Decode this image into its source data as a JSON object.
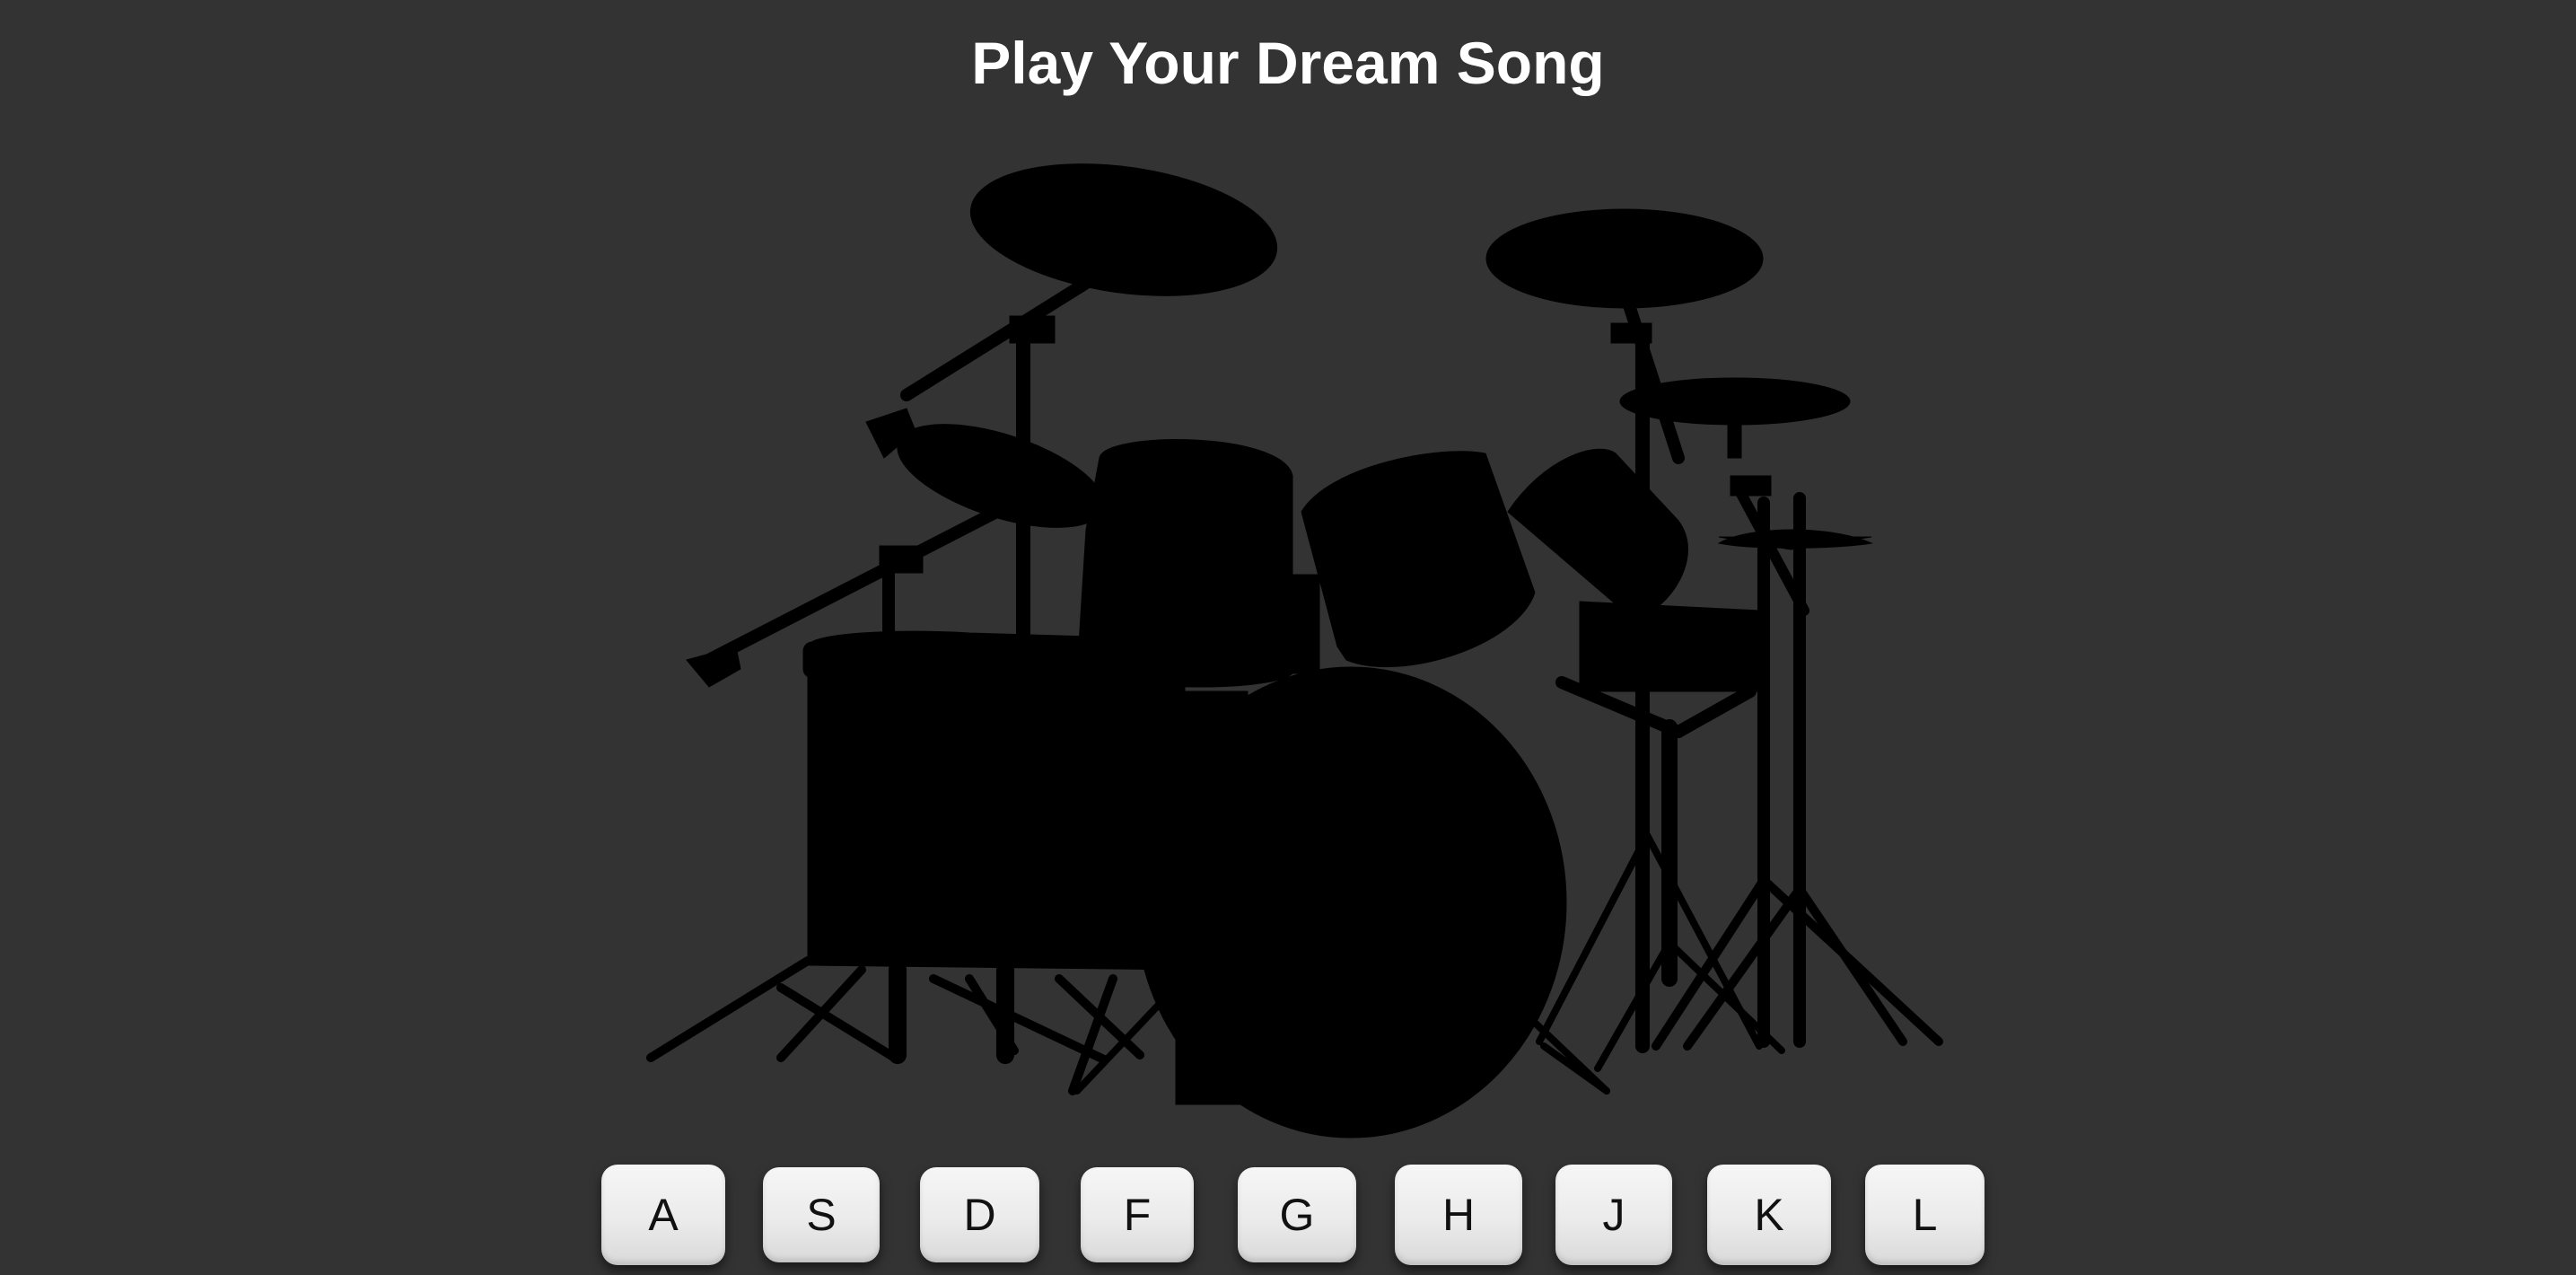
{
  "page": {
    "title": "Play Your Dream Song"
  },
  "colors": {
    "background": "#333333",
    "silhouette": "#000000",
    "title_text": "#ffffff",
    "key_face": "#efefef",
    "key_text": "#111111"
  },
  "drum_kit": {
    "icon": "drum-kit-silhouette",
    "pieces": [
      "crash-cymbal-left",
      "ride-cymbal",
      "hi-hat",
      "splash-cymbal",
      "crash-cymbal-right",
      "rack-tom-1",
      "rack-tom-2",
      "rack-tom-3",
      "floor-tom",
      "bass-drum"
    ]
  },
  "keys": [
    {
      "label": "A"
    },
    {
      "label": "S"
    },
    {
      "label": "D"
    },
    {
      "label": "F"
    },
    {
      "label": "G"
    },
    {
      "label": "H"
    },
    {
      "label": "J"
    },
    {
      "label": "K"
    },
    {
      "label": "L"
    }
  ]
}
